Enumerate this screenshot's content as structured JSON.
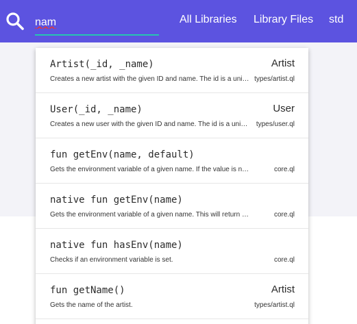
{
  "colors": {
    "header": "#5c53e0",
    "input_underline": "#26c6b0",
    "page_background": "#f3f3f8"
  },
  "search": {
    "icon": "search-icon",
    "value": "nam"
  },
  "nav": {
    "items": [
      {
        "label": "All Libraries"
      },
      {
        "label": "Library Files"
      },
      {
        "label": "std"
      }
    ]
  },
  "results": [
    {
      "signature": "Artist(_id, _name)",
      "kind": "Artist",
      "description": "Creates a new artist with the given ID and name. The id is a unique identifier.",
      "file": "types/artist.ql"
    },
    {
      "signature": "User(_id, _name)",
      "kind": "User",
      "description": "Creates a new user with the given ID and name. The id is a unique identifier.",
      "file": "types/user.ql"
    },
    {
      "signature": "fun getEnv(name, default)",
      "kind": "",
      "description": "Gets the environment variable of a given name. If the value is not set, returns the default.",
      "file": "core.ql"
    },
    {
      "signature": "native fun getEnv(name)",
      "kind": "",
      "description": "Gets the environment variable of a given name. This will return null if not set.",
      "file": "core.ql"
    },
    {
      "signature": "native fun hasEnv(name)",
      "kind": "",
      "description": "Checks if an environment variable is set.",
      "file": "core.ql"
    },
    {
      "signature": "fun getName()",
      "kind": "Artist",
      "description": "Gets the name of the artist.",
      "file": "types/artist.ql"
    }
  ]
}
